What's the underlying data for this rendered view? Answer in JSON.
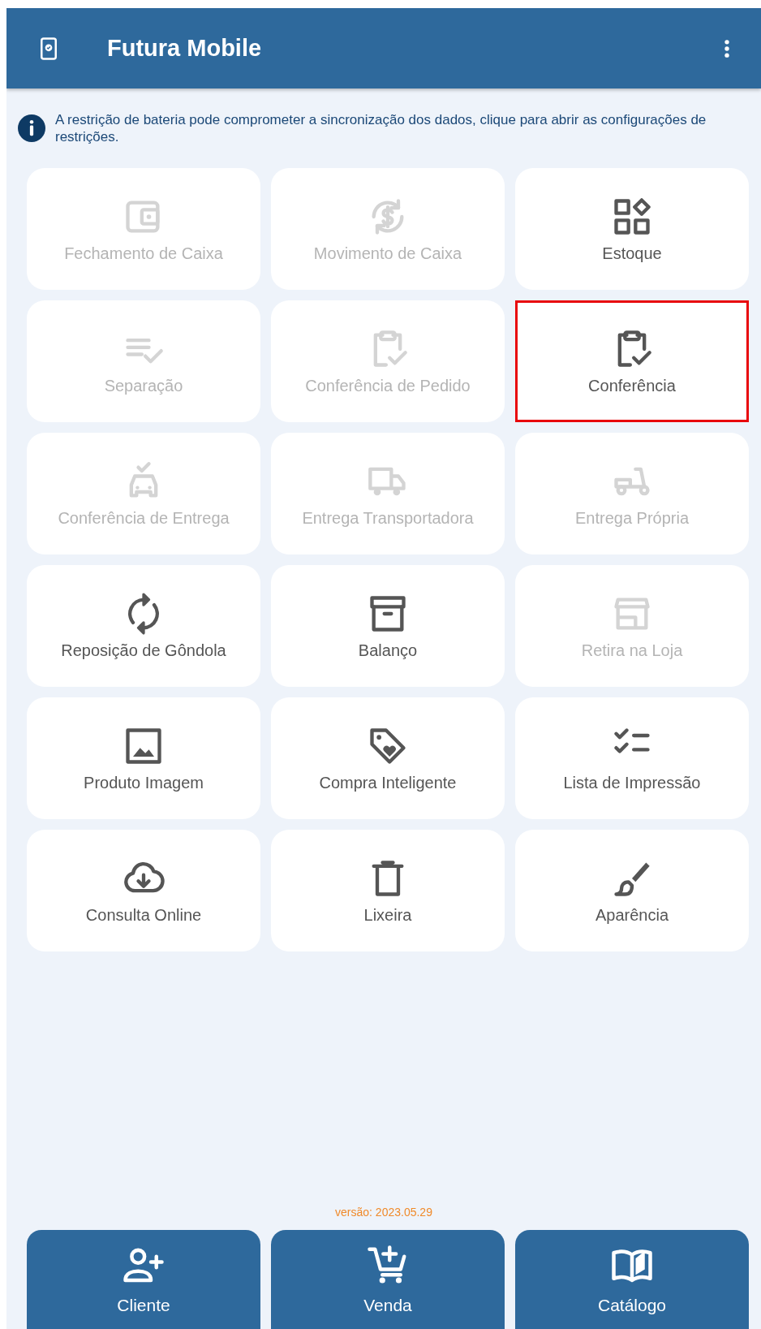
{
  "app_bar": {
    "title": "Futura Mobile"
  },
  "notice": {
    "text": "A restrição de bateria pode comprometer a sincronização dos dados, clique para abrir as configurações de restrições."
  },
  "tiles": [
    {
      "label": "Fechamento de Caixa",
      "disabled": true,
      "highlighted": false
    },
    {
      "label": "Movimento de Caixa",
      "disabled": true,
      "highlighted": false
    },
    {
      "label": "Estoque",
      "disabled": false,
      "highlighted": false
    },
    {
      "label": "Separação",
      "disabled": true,
      "highlighted": false
    },
    {
      "label": "Conferência de Pedido",
      "disabled": true,
      "highlighted": false
    },
    {
      "label": "Conferência",
      "disabled": false,
      "highlighted": true
    },
    {
      "label": "Conferência de Entrega",
      "disabled": true,
      "highlighted": false
    },
    {
      "label": "Entrega Transportadora",
      "disabled": true,
      "highlighted": false
    },
    {
      "label": "Entrega Própria",
      "disabled": true,
      "highlighted": false
    },
    {
      "label": "Reposição de Gôndola",
      "disabled": false,
      "highlighted": false
    },
    {
      "label": "Balanço",
      "disabled": false,
      "highlighted": false
    },
    {
      "label": "Retira na Loja",
      "disabled": true,
      "highlighted": false
    },
    {
      "label": "Produto Imagem",
      "disabled": false,
      "highlighted": false
    },
    {
      "label": "Compra Inteligente",
      "disabled": false,
      "highlighted": false
    },
    {
      "label": "Lista de Impressão",
      "disabled": false,
      "highlighted": false
    },
    {
      "label": "Consulta Online",
      "disabled": false,
      "highlighted": false
    },
    {
      "label": "Lixeira",
      "disabled": false,
      "highlighted": false
    },
    {
      "label": "Aparência",
      "disabled": false,
      "highlighted": false
    }
  ],
  "version": "versão: 2023.05.29",
  "bottom_buttons": [
    {
      "label": "Cliente"
    },
    {
      "label": "Venda"
    },
    {
      "label": "Catálogo"
    }
  ]
}
